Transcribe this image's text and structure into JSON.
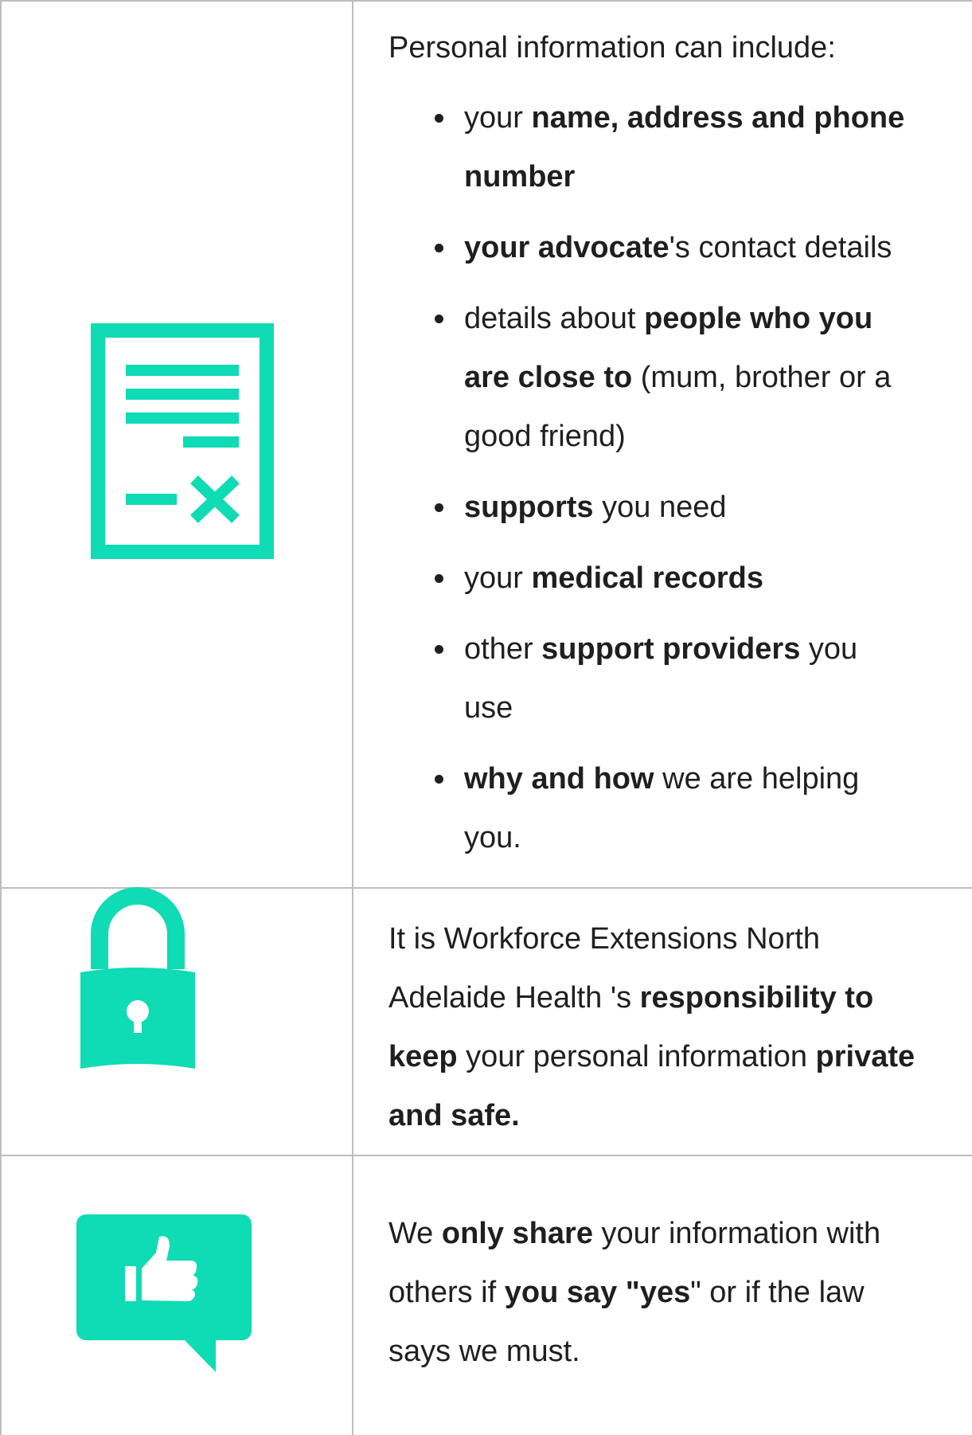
{
  "colors": {
    "accent": "#0fdbb4",
    "grid": "#bdbdbd",
    "text": "#1f1f1f"
  },
  "rows": [
    {
      "icon": "document-icon",
      "intro": "Personal information can include:",
      "bullets": [
        {
          "l1": [
            "your ",
            "name, address and phone"
          ],
          "l2": [
            "number"
          ]
        },
        {
          "l1": [
            "your advocate",
            "'s contact details"
          ]
        },
        {
          "l1": [
            "details about ",
            "people who you"
          ],
          "l2": [
            "are close to",
            " (mum, brother or a"
          ],
          "l3": "good friend)"
        },
        {
          "l1": [
            "supports",
            " you need"
          ]
        },
        {
          "l1": [
            "your ",
            "medical records"
          ]
        },
        {
          "l1": [
            "other ",
            "support providers",
            " you"
          ],
          "l2": [
            "use"
          ]
        },
        {
          "l1": [
            "why and how",
            " we are helping"
          ],
          "l2": [
            "you."
          ]
        }
      ]
    },
    {
      "icon": "padlock-icon",
      "text": {
        "l1": "It is Workforce Extensions  North",
        "l2a": "Adelaide Health 's ",
        "l2b": "responsibility to",
        "l3a": "keep",
        "l3b": " your personal information ",
        "l3c": "private",
        "l4": "and safe."
      }
    },
    {
      "icon": "thumbs-up-speech-icon",
      "text": {
        "l1a": "We ",
        "l1b": "only share",
        "l1c": " your information with",
        "l2a": "others if ",
        "l2b": "you say \"yes",
        "l2c": "\" or if the law",
        "l3": "says we must."
      }
    }
  ]
}
